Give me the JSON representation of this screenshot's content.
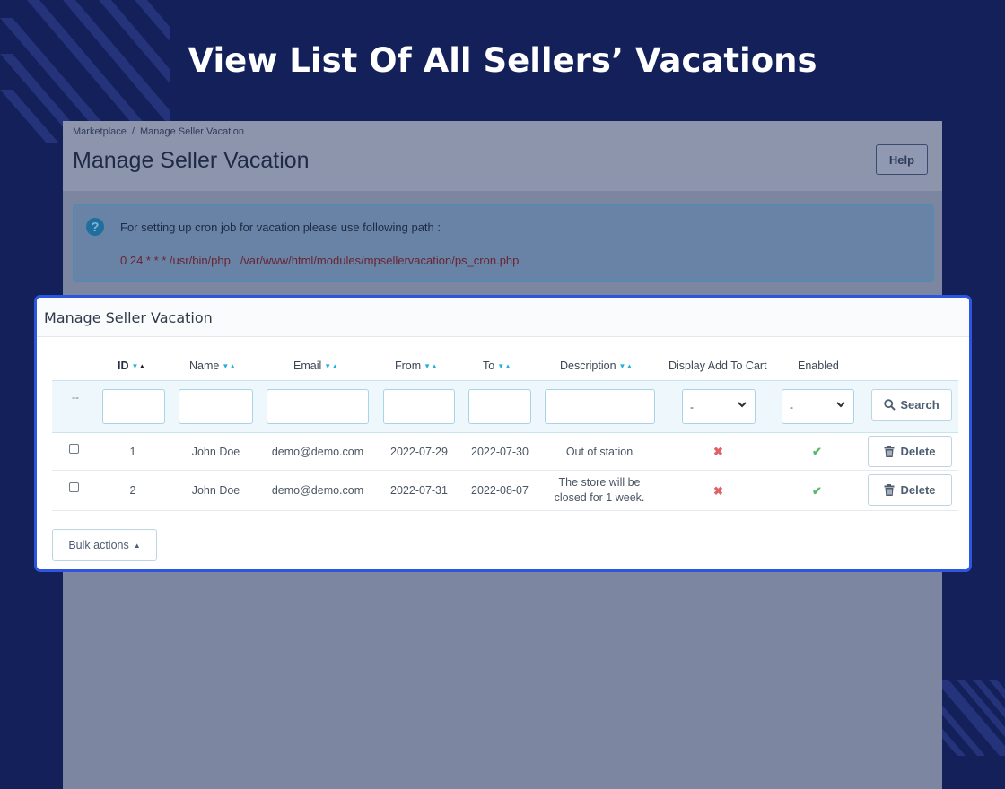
{
  "headline": "View List Of All Sellers’ Vacations",
  "breadcrumb": {
    "parent": "Marketplace",
    "separator": "/",
    "current": "Manage Seller Vacation"
  },
  "admin_title": "Manage Seller Vacation",
  "help_label": "Help",
  "cron": {
    "icon": "question-icon",
    "text": "For setting up cron job for vacation please use following path :",
    "path": "0 24 * * * /usr/bin/php   /var/www/html/modules/mpsellervacation/ps_cron.php"
  },
  "panel": {
    "title": "Manage Seller Vacation",
    "columns": {
      "id": "ID",
      "name": "Name",
      "email": "Email",
      "from": "From",
      "to": "To",
      "description": "Description",
      "display_add_to_cart": "Display Add To Cart",
      "enabled": "Enabled"
    },
    "filter": {
      "dash": "--",
      "display_add_to_cart_value": "-",
      "enabled_value": "-",
      "search_label": "Search"
    },
    "rows": [
      {
        "id": "1",
        "name": "John Doe",
        "email": "demo@demo.com",
        "from": "2022-07-29",
        "to": "2022-07-30",
        "description": "Out of station",
        "display_add_to_cart": "no",
        "enabled": "yes",
        "delete_label": "Delete"
      },
      {
        "id": "2",
        "name": "John Doe",
        "email": "demo@demo.com",
        "from": "2022-07-31",
        "to": "2022-08-07",
        "description": "The store will be closed for 1 week.",
        "display_add_to_cart": "no",
        "enabled": "yes",
        "delete_label": "Delete"
      }
    ],
    "bulk_actions_label": "Bulk actions"
  },
  "colors": {
    "background": "#13205a",
    "highlight_border": "#2e55e0",
    "sort_arrow": "#22b0d8",
    "disabled_icon": "#e06266",
    "enabled_icon": "#58b86c"
  }
}
